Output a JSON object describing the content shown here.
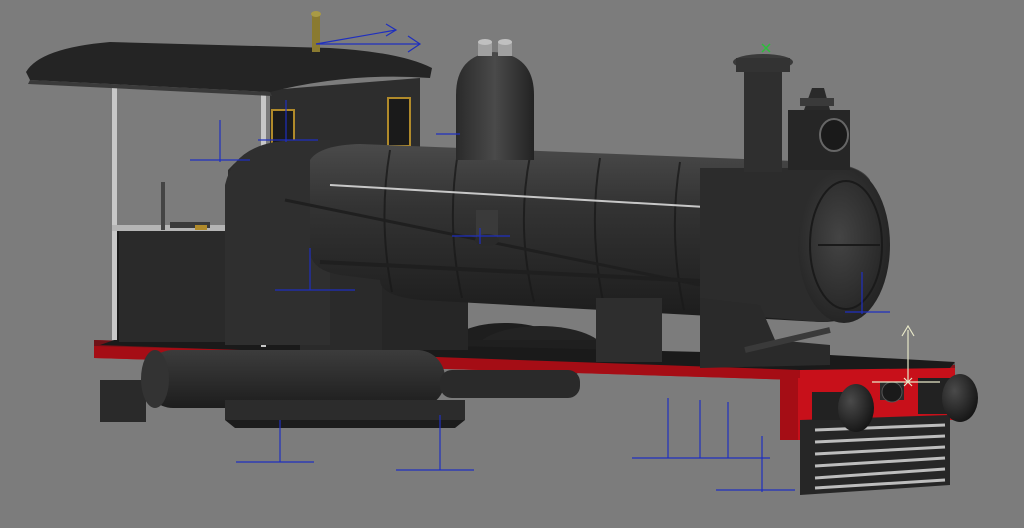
{
  "viewport": {
    "background": "#7c7c7c",
    "model": "steam-locomotive",
    "gizmo_color": "#1f2fbf",
    "frame_color": "#c8101a",
    "body_color": "#2b2b2b",
    "cab_window_color": "#b08a2a",
    "selection_marker_color": "#2bbf3a"
  }
}
